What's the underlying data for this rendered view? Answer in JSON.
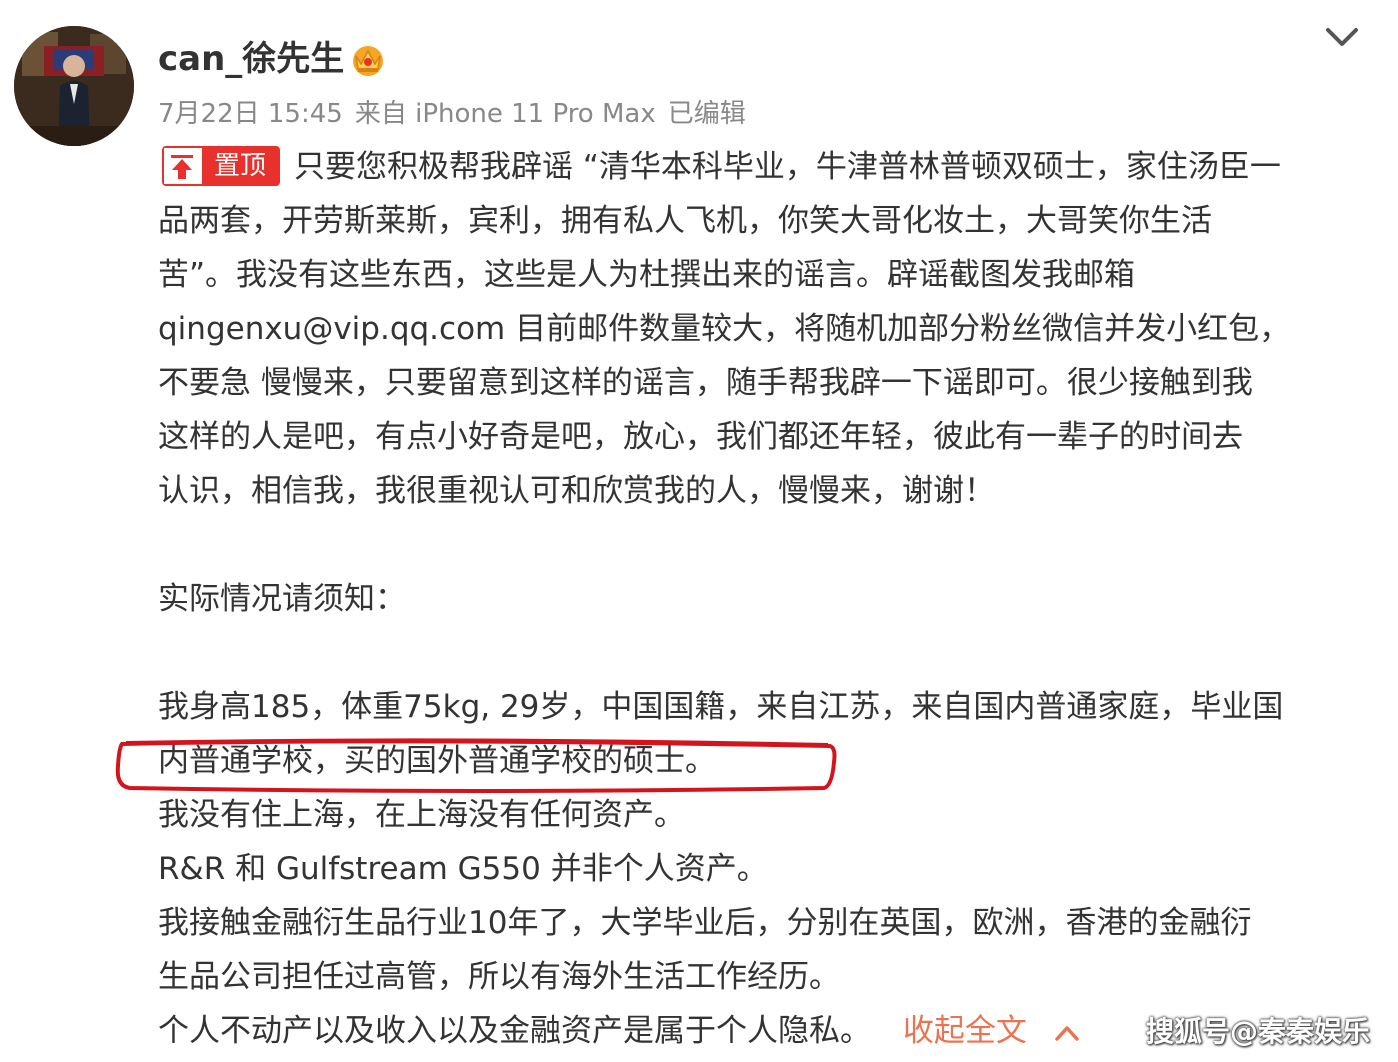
{
  "post": {
    "username": "can_徐先生",
    "meta": {
      "date": "7月22日 15:45",
      "source": "来自 iPhone 11 Pro Max",
      "edited": "已编辑"
    },
    "pin_label": "置顶",
    "lines": [
      "只要您积极帮我辟谣 “清华本科毕业，牛津普林普顿双硕士，家住汤臣一",
      "品两套，开劳斯莱斯，宾利，拥有私人飞机，你笑大哥化妆土，大哥笑你生活",
      "苦”。我没有这些东西，这些是人为杜撰出来的谣言。辟谣截图发我邮箱",
      "qingenxu@vip.qq.com  目前邮件数量较大，将随机加部分粉丝微信并发小红包，",
      "不要急 慢慢来，只要留意到这样的谣言，随手帮我辟一下谣即可。很少接触到我",
      "这样的人是吧，有点小好奇是吧，放心，我们都还年轻，彼此有一辈子的时间去",
      "认识，相信我，我很重视认可和欣赏我的人，慢慢来，谢谢！",
      "实际情况请须知：",
      "我身高185，体重75kg, 29岁，中国国籍，来自江苏，来自国内普通家庭，毕业国",
      "内普通学校，买的国外普通学校的硕士。",
      "我没有住上海，在上海没有任何资产。",
      "R&R 和  Gulfstream G550  并非个人资产。",
      "我接触金融衍生品行业10年了，大学毕业后，分别在英国，欧洲，香港的金融衍",
      "生品公司担任过高管，所以有海外生活工作经历。",
      "个人不动产以及收入以及金融资产是属于个人隐私。"
    ],
    "collapse_label": "收起全文",
    "collapse_arrow": "^"
  },
  "watermark": "搜狐号@秦秦娱乐",
  "icons": {
    "avatar": "avatar",
    "vip_badge": "crown-badge-icon",
    "dropdown": "chevron-down-icon",
    "pin": "pin-up-arrow-icon"
  },
  "colors": {
    "accent_red": "#e8312d",
    "link_orange": "#eb7350",
    "meta_gray": "#888888",
    "text": "#333333"
  }
}
